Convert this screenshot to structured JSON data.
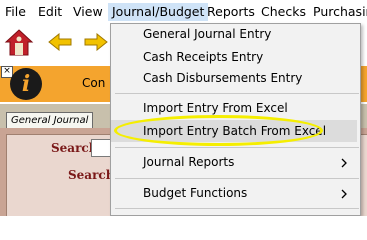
{
  "menubar": {
    "items": [
      "File",
      "Edit",
      "View",
      "Journal/Budget",
      "Reports",
      "Checks",
      "Purchasing"
    ]
  },
  "info_bar": {
    "text": "Con"
  },
  "tabs": {
    "general_journal": "General Journal"
  },
  "panel": {
    "search_label_1": "Search",
    "search_label_2": "Search"
  },
  "dropdown": {
    "items": [
      "General Journal Entry",
      "Cash Receipts Entry",
      "Cash Disbursements Entry",
      "Import Entry From Excel",
      "Import Entry Batch From Excel",
      "Journal Reports",
      "Budget Functions"
    ],
    "submenu_arrow": ">"
  },
  "colors": {
    "menu_active": "#cfe3f7",
    "info_bar": "#f4a42e",
    "highlight_ring": "#f5ee00",
    "label_maroon": "#7a1818"
  },
  "icons": [
    "app-logo-icon",
    "back-arrow-icon",
    "forward-arrow-icon",
    "close-icon",
    "info-icon",
    "chevron-right-icon"
  ]
}
